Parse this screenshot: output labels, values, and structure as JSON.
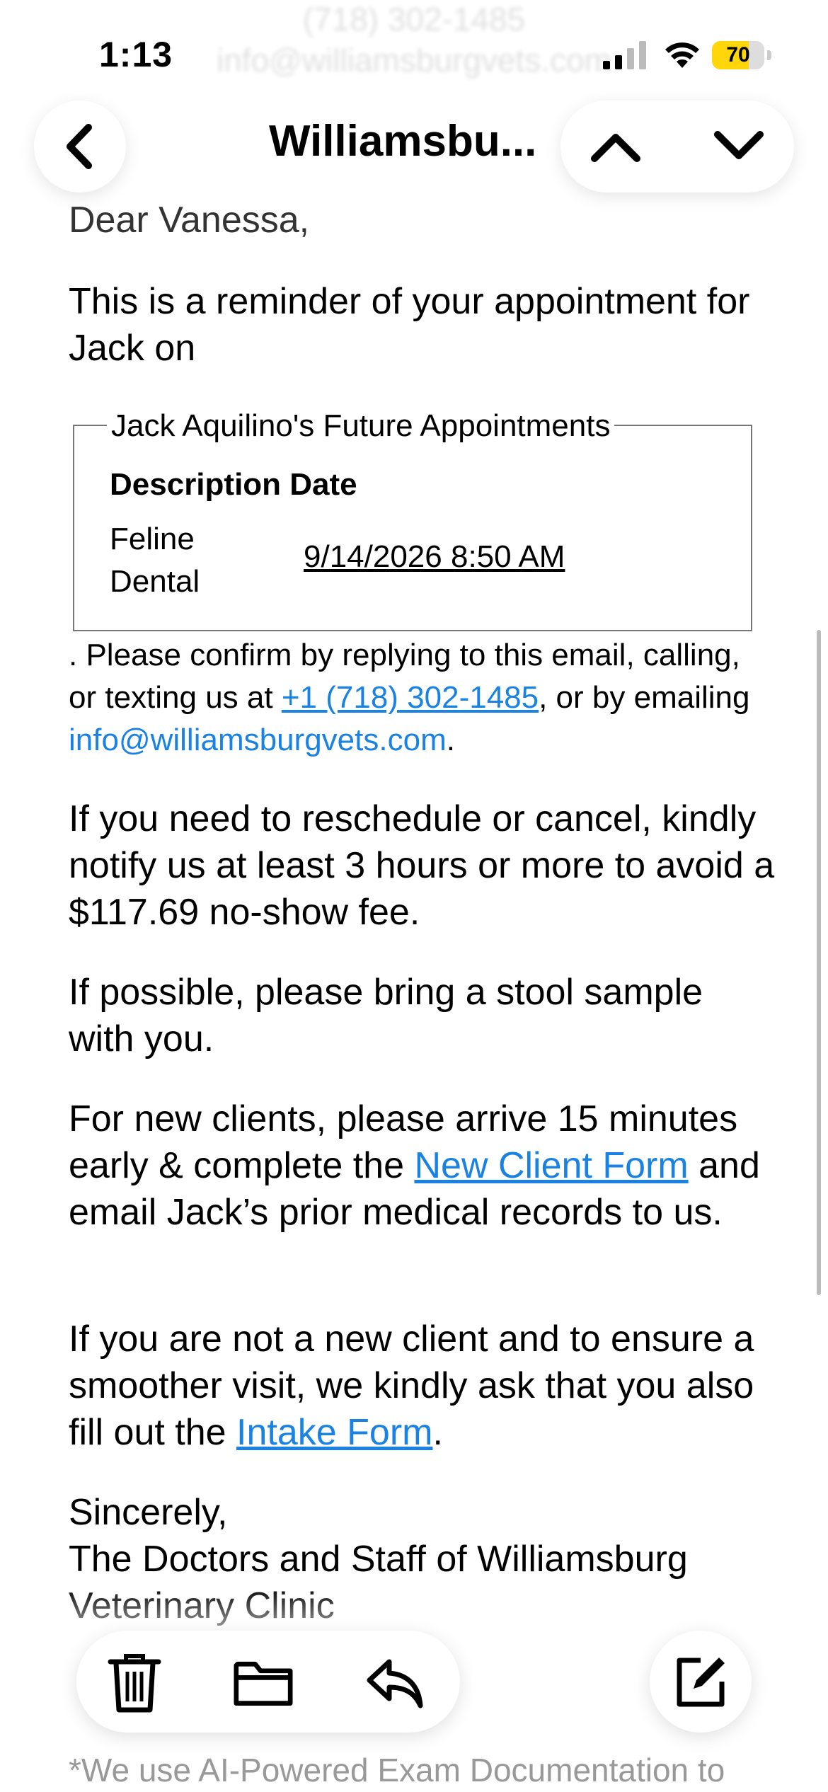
{
  "header_blur": {
    "phone": "(718) 302-1485",
    "email": "info@williamsburgvets.com"
  },
  "status_bar": {
    "time": "1:13",
    "battery": "70",
    "battery_level": 0.7
  },
  "nav": {
    "title": "Williamsbu..."
  },
  "email": {
    "greeting": "Dear Vanessa,",
    "intro": "This is a reminder of your appointment for Jack on",
    "appointments": {
      "legend": "Jack Aquilino's Future Appointments",
      "header": "Description Date",
      "description": "Feline Dental",
      "date": "9/14/2026 8:50 AM"
    },
    "confirm_prefix": ". Please confirm by replying to this email, calling, or texting us at ",
    "phone_link": "+1 (718) 302-1485",
    "confirm_mid": ", or by emailing ",
    "email_link": "info@williamsburgvets.com",
    "confirm_suffix": ".",
    "reschedule": "If you need to reschedule or cancel, kindly notify us at least 3 hours or more to avoid a $117.69 no-show fee.",
    "stool": "If possible, please bring a stool sample with you.",
    "new_clients_prefix": "For new clients, please arrive 15 minutes early & complete the ",
    "new_client_form_link": "New Client Form",
    "new_clients_suffix": " and email Jack’s prior medical records to us.",
    "existing_prefix": "If you are not a new client and to ensure a smoother visit, we kindly ask that you also fill out the ",
    "intake_form_link": " Intake Form",
    "existing_suffix": ".",
    "sincerely": "Sincerely,",
    "signature": "The Doctors and Staff of Williamsburg Veterinary Clinic",
    "footer_note": "*We use AI-Powered Exam Documentation to"
  },
  "icons": {
    "back": "chevron-left-icon",
    "prev": "chevron-up-icon",
    "next": "chevron-down-icon",
    "trash": "trash-icon",
    "folder": "folder-icon",
    "reply": "reply-icon",
    "compose": "compose-icon"
  },
  "colors": {
    "link": "#1a82e2",
    "battery_fill": "#ffd60a"
  }
}
